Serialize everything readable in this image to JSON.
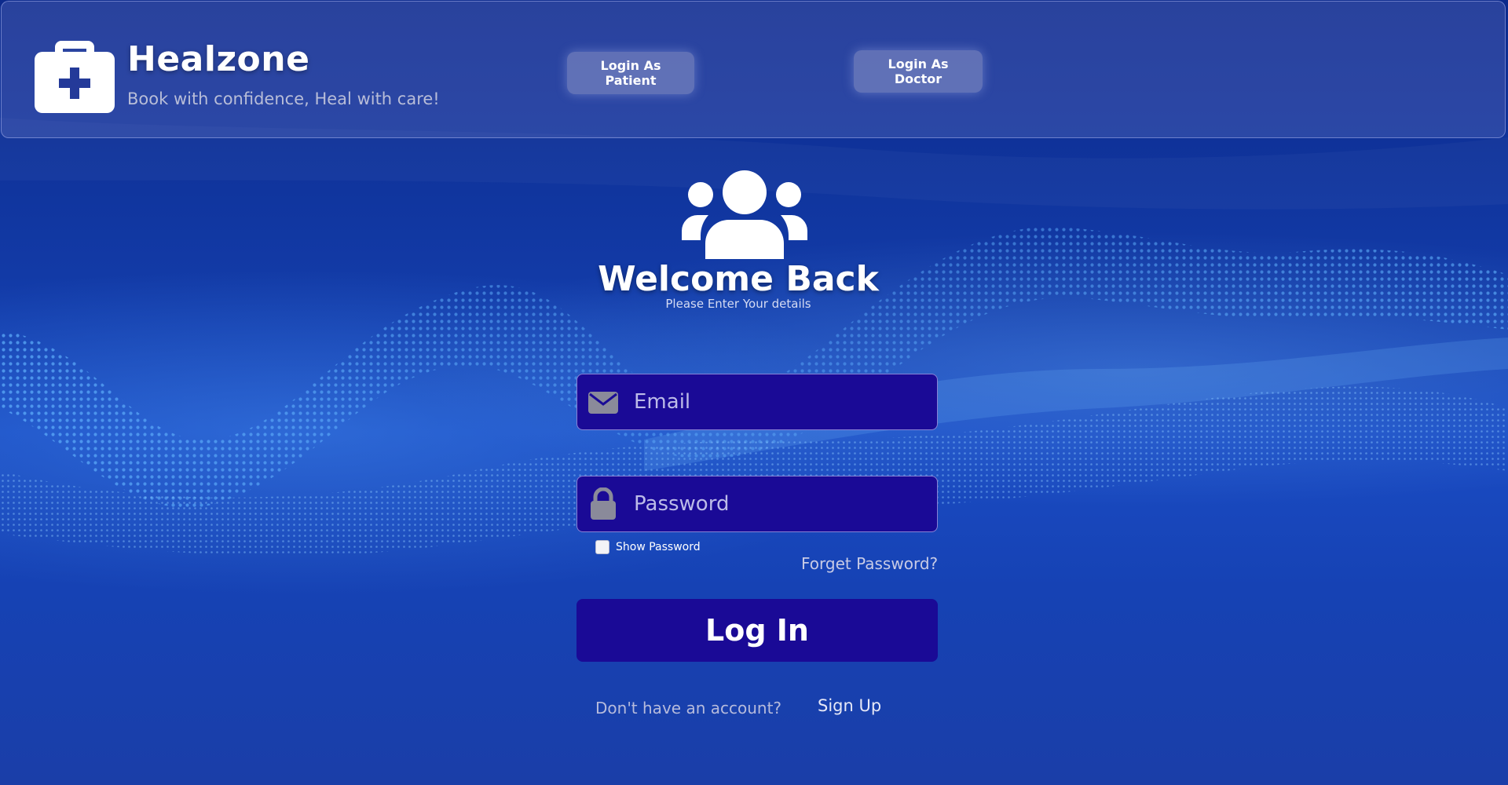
{
  "header": {
    "brand_name": "Healzone",
    "tagline": "Book with confidence, Heal with care!",
    "brand_icon": "medical-kit-icon",
    "login_patient_label": "Login As Patient",
    "login_doctor_label": "Login As Doctor"
  },
  "login": {
    "icon": "users-group-icon",
    "title": "Welcome Back",
    "subtitle": "Please Enter Your details",
    "email": {
      "icon": "envelope-icon",
      "placeholder": "Email",
      "value": ""
    },
    "password": {
      "icon": "lock-icon",
      "placeholder": "Password",
      "value": ""
    },
    "show_password_label": "Show Password",
    "show_password_checked": false,
    "forgot_label": "Forget Password?",
    "submit_label": "Log In",
    "no_account_text": "Don't have an account?",
    "signup_label": "Sign Up"
  },
  "colors": {
    "background_top": "#0c2a8c",
    "background_bottom": "#1a4cc4",
    "field_fill": "#1a0a96",
    "button_fill": "#1a0a96",
    "header_button_fill": "#8c96c8"
  }
}
